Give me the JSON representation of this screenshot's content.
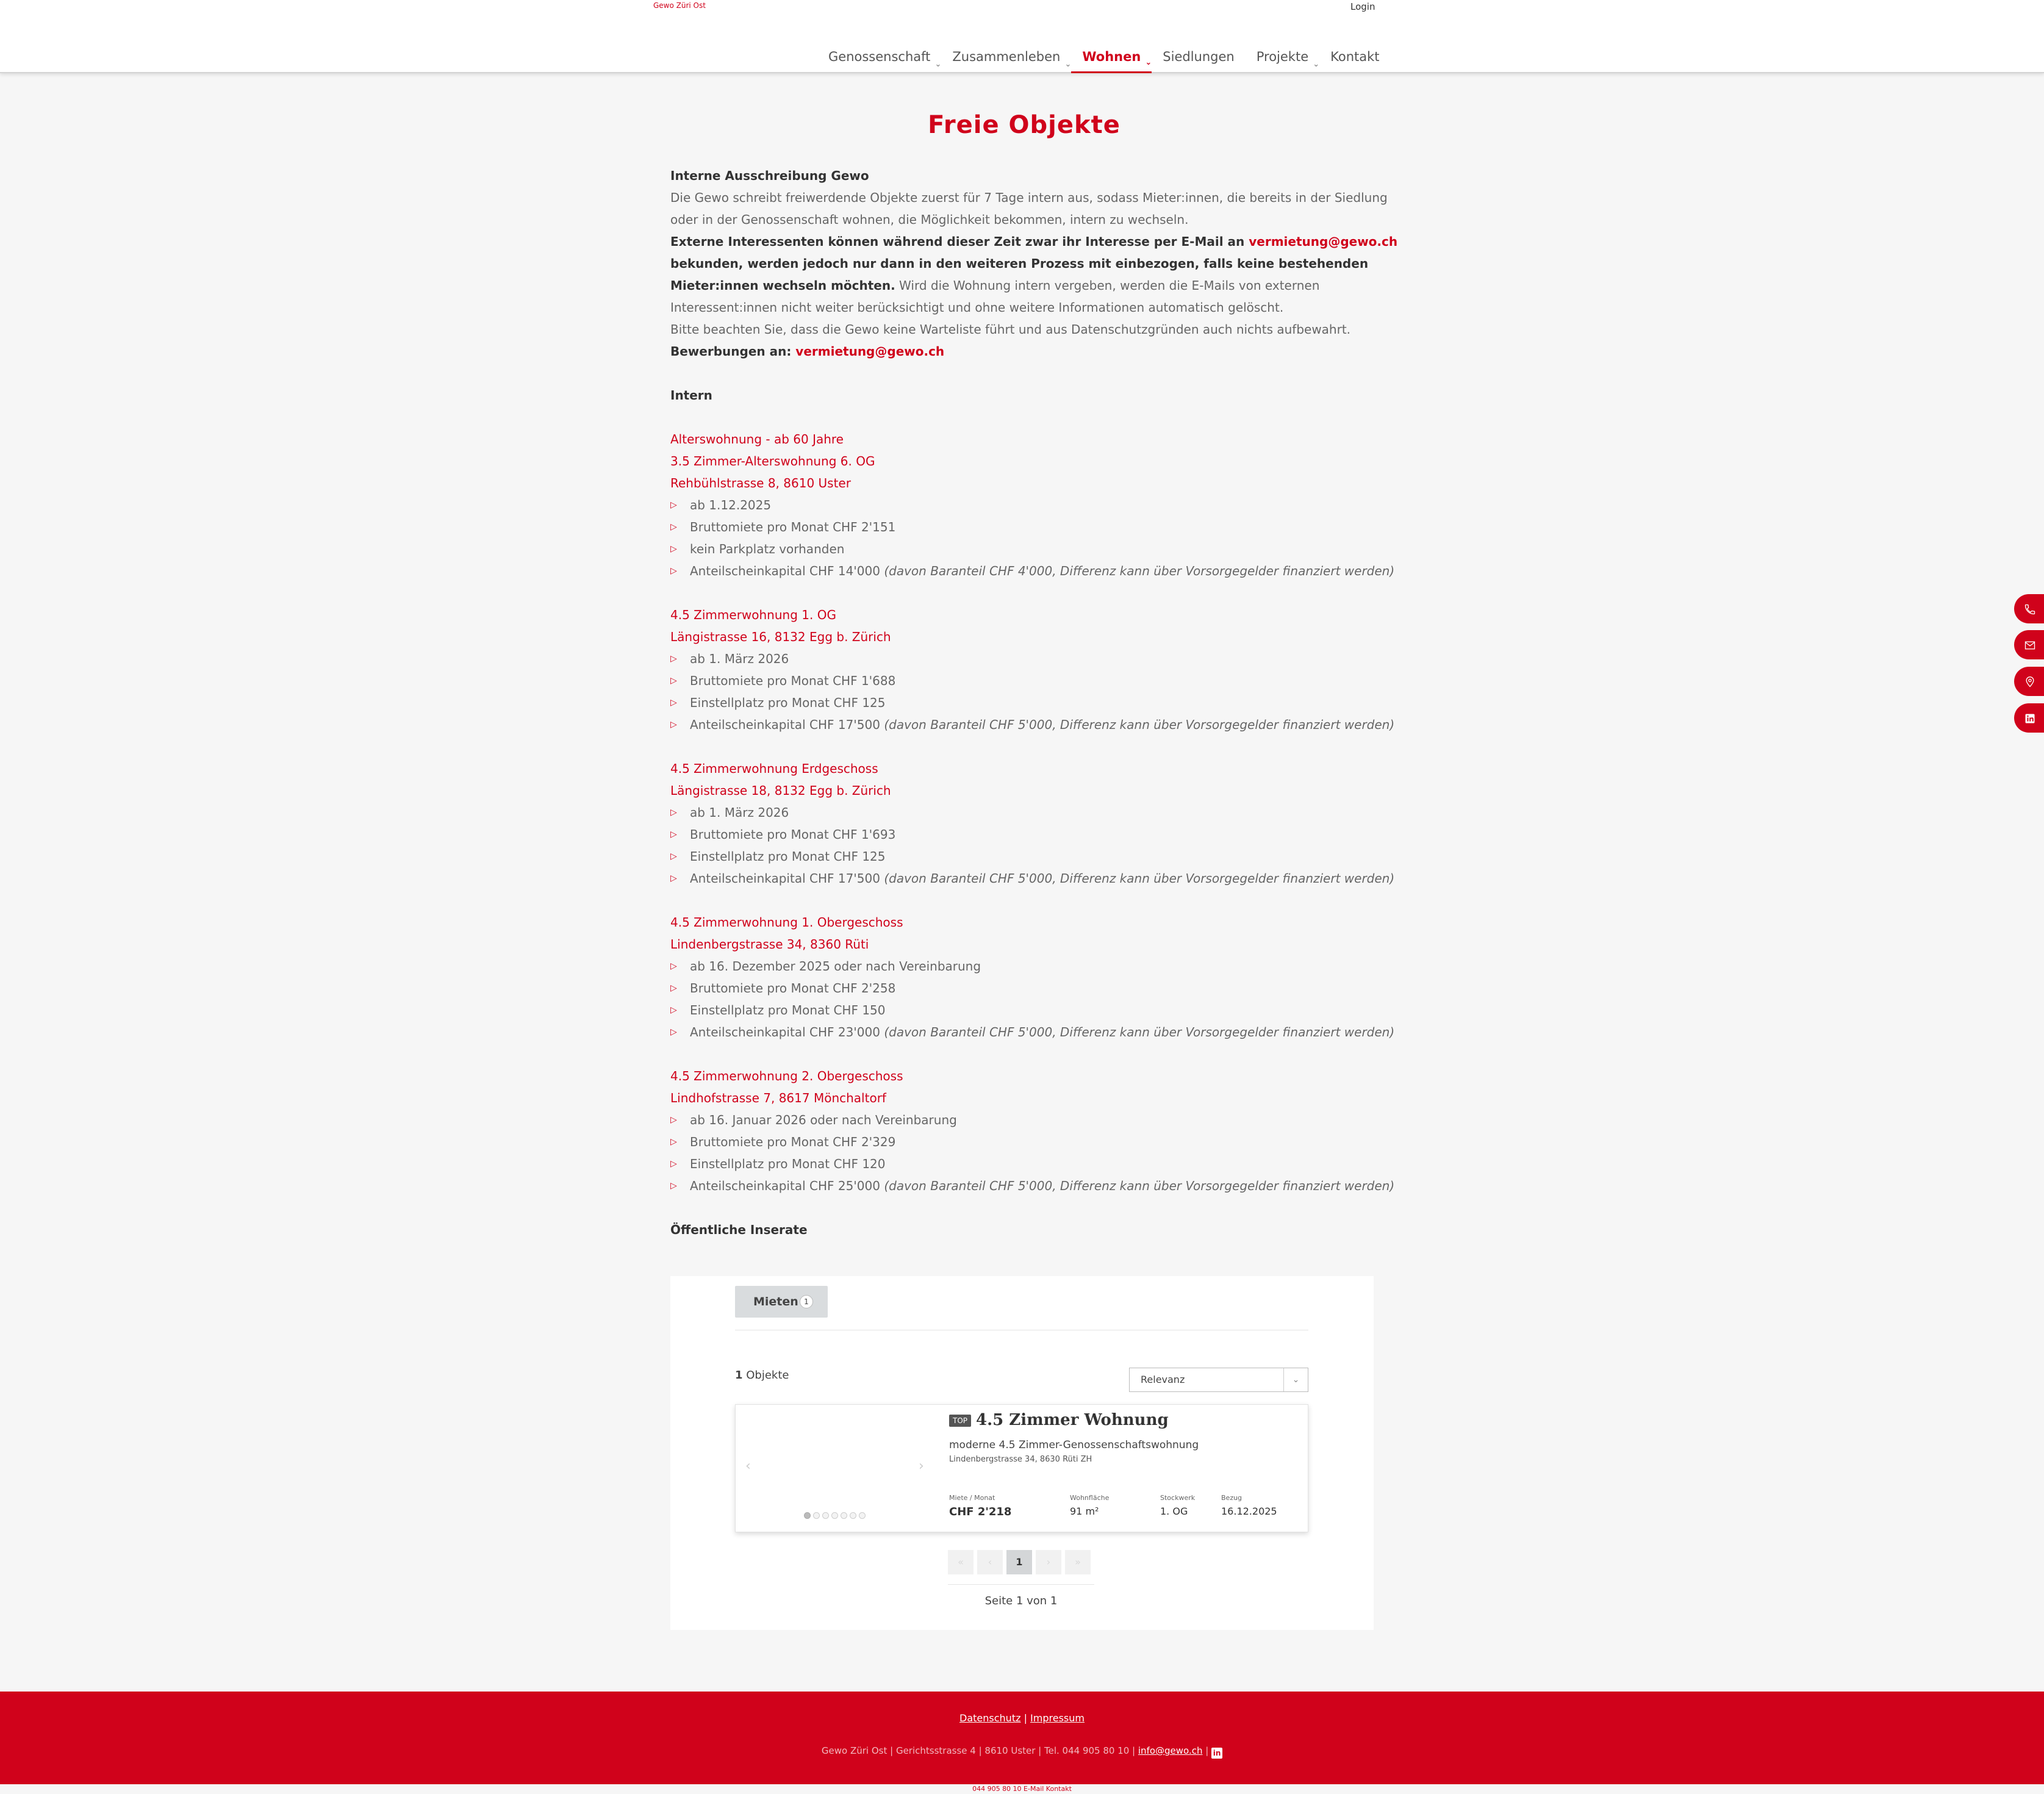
{
  "header": {
    "logo_text": "Gewo Züri Ost",
    "login": "Login",
    "nav": [
      {
        "label": "Genossenschaft",
        "chev": "⌄"
      },
      {
        "label": "Zusammenleben",
        "chev": "⌄"
      },
      {
        "label": "Wohnen",
        "chev": "⌄"
      },
      {
        "label": "Siedlungen"
      },
      {
        "label": "Projekte",
        "chev": "⌄"
      },
      {
        "label": "Kontakt"
      }
    ]
  },
  "page": {
    "title": "Freie Objekte",
    "intro_heading": "Interne Ausschreibung Gewo",
    "intro_1": "Die Gewo schreibt freiwerdende Objekte zuerst für 7 Tage intern aus, sodass Mieter:innen, die bereits in der Siedlung",
    "intro_2": "oder in der Genossenschaft wohnen, die Möglichkeit bekommen, intern zu wechseln.",
    "ext_1": "Externe Interessenten können während dieser Zeit zwar ihr Interesse per E-Mail an ",
    "email": "vermietung@gewo.ch",
    "ext_2": "bekunden, werden jedoch nur dann in den weiteren Prozess mit einbezogen, falls keine bestehenden",
    "ext_3": "Mieter:innen wechseln möchten.",
    "ext_3b": " Wird die Wohnung intern vergeben, werden die E-Mails von externen",
    "ext_4": "Interessent:innen nicht weiter berücksichtigt und ohne weitere Informationen automatisch gelöscht.",
    "ext_5": "Bitte beachten Sie, dass die Gewo keine Warteliste führt und aus Datenschutzgründen auch nichts aufbewahrt.",
    "apply_label": "Bewerbungen an: ",
    "intern_heading": "Intern",
    "public_heading": "Öffentliche Inserate"
  },
  "listings": [
    {
      "lines": [
        "Alterswohnung - ab 60 Jahre",
        "3.5 Zimmer-Alterswohnung 6. OG",
        "Rehbühlstrasse 8, 8610 Uster"
      ],
      "items": [
        "ab 1.12.2025",
        "Bruttomiete pro Monat CHF 2'151",
        "kein Parkplatz vorhanden",
        "Anteilscheinkapital CHF 14'000 "
      ],
      "note": "(davon Baranteil CHF 4'000, Differenz kann über Vorsorgegelder finanziert werden)"
    },
    {
      "lines": [
        "4.5 Zimmerwohnung 1. OG",
        "Längistrasse 16, 8132 Egg b. Zürich"
      ],
      "items": [
        "ab 1. März 2026",
        "Bruttomiete pro Monat CHF 1'688",
        "Einstellplatz pro Monat CHF 125",
        "Anteilscheinkapital CHF 17'500 "
      ],
      "note": "(davon Baranteil CHF 5'000, Differenz kann über Vorsorgegelder finanziert werden)"
    },
    {
      "lines": [
        "4.5 Zimmerwohnung Erdgeschoss",
        "Längistrasse 18, 8132 Egg b. Zürich"
      ],
      "items": [
        "ab 1. März 2026",
        "Bruttomiete pro Monat CHF 1'693",
        "Einstellplatz pro Monat CHF 125",
        "Anteilscheinkapital CHF 17'500 "
      ],
      "note": "(davon Baranteil CHF 5'000, Differenz kann über Vorsorgegelder finanziert werden)"
    },
    {
      "lines": [
        "4.5 Zimmerwohnung 1. Obergeschoss",
        "Lindenbergstrasse 34, 8360 Rüti"
      ],
      "items": [
        "ab 16. Dezember 2025 oder nach Vereinbarung",
        "Bruttomiete pro Monat CHF 2'258",
        "Einstellplatz pro Monat CHF 150",
        "Anteilscheinkapital CHF 23'000 "
      ],
      "note": "(davon Baranteil CHF 5'000, Differenz kann über Vorsorgegelder finanziert werden)"
    },
    {
      "lines": [
        "4.5 Zimmerwohnung 2. Obergeschoss",
        "Lindhofstrasse 7, 8617 Mönchaltorf"
      ],
      "items": [
        "ab 16. Januar 2026 oder nach Vereinbarung",
        "Bruttomiete pro Monat CHF 2'329",
        "Einstellplatz pro Monat CHF 120",
        "Anteilscheinkapital CHF 25'000 "
      ],
      "note": "(davon Baranteil CHF 5'000, Differenz kann über Vorsorgegelder finanziert werden)"
    }
  ],
  "widget": {
    "tab_label": "Mieten",
    "tab_count": "1",
    "count_num": "1",
    "count_label": " Objekte",
    "sort_value": "Relevanz",
    "card": {
      "badge": "TOP",
      "title": "4.5 Zimmer Wohnung",
      "subtitle": "moderne 4.5 Zimmer-Genossenschaftswohnung",
      "address": "Lindenbergstrasse 34, 8630 Rüti ZH",
      "specs": [
        {
          "label": "Miete / Monat",
          "value": "CHF 2'218"
        },
        {
          "label": "Wohnfläche",
          "value": "91 m²"
        },
        {
          "label": "Stockwerk",
          "value": "1. OG"
        },
        {
          "label": "Bezug",
          "value": "16.12.2025"
        }
      ]
    },
    "pager": {
      "first": "«",
      "prev": "‹",
      "current": "1",
      "next": "›",
      "last": "»",
      "info": "Seite 1 von 1"
    }
  },
  "side_icons": [
    "phone-icon",
    "mail-icon",
    "location-icon",
    "linkedin-icon"
  ],
  "footer": {
    "privacy": "Datenschutz",
    "sep": " | ",
    "imprint": "Impressum",
    "address": "Gewo Züri Ost | Gerichtsstrasse 4 | 8610 Uster | Tel. 044 905 80 10 | ",
    "email": "info@gewo.ch",
    "sep2": " | ",
    "bottom": "044 905 80 10 E-Mail Kontakt"
  },
  "colors": {
    "brand": "#d0021b",
    "background": "#f6f6f6"
  }
}
